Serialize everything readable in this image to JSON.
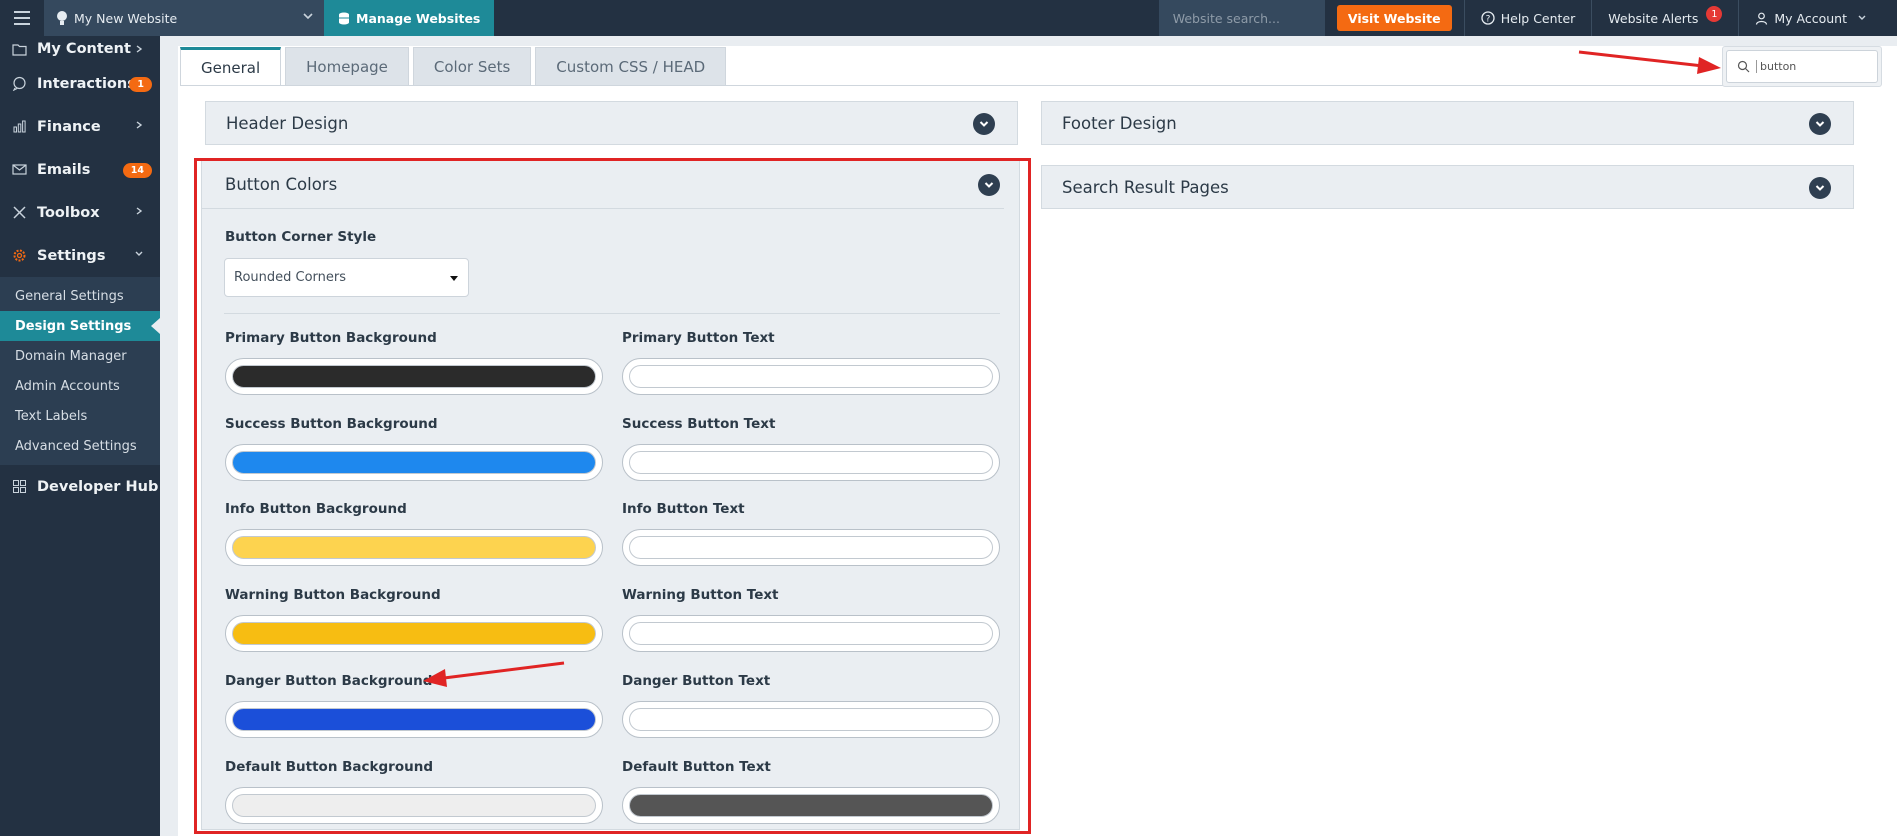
{
  "topbar": {
    "site_name": "My New Website",
    "manage_label": "Manage Websites",
    "search_placeholder": "Website search...",
    "visit_label": "Visit Website",
    "help_label": "Help Center",
    "alerts_label": "Website Alerts",
    "alerts_count": "1",
    "account_label": "My Account"
  },
  "sidebar": {
    "items": [
      {
        "label": "My Content",
        "icon": "folder-icon"
      },
      {
        "label": "Interactions",
        "icon": "chat-icon",
        "badge": "1"
      },
      {
        "label": "Finance",
        "icon": "bar-chart-icon"
      },
      {
        "label": "Emails",
        "icon": "envelope-icon",
        "badge": "14"
      },
      {
        "label": "Toolbox",
        "icon": "tools-icon"
      },
      {
        "label": "Settings",
        "icon": "gear-icon"
      }
    ],
    "settings_sub": [
      {
        "label": "General Settings"
      },
      {
        "label": "Design Settings"
      },
      {
        "label": "Domain Manager"
      },
      {
        "label": "Admin Accounts"
      },
      {
        "label": "Text Labels"
      },
      {
        "label": "Advanced Settings"
      }
    ],
    "developer_hub": "Developer Hub"
  },
  "tabs": [
    {
      "label": "General"
    },
    {
      "label": "Homepage"
    },
    {
      "label": "Color Sets"
    },
    {
      "label": "Custom CSS / HEAD"
    }
  ],
  "settings_search": {
    "value": "button"
  },
  "panels": {
    "header_design": "Header Design",
    "footer_design": "Footer Design",
    "search_result_pages": "Search Result Pages",
    "button_colors": "Button Colors"
  },
  "button_colors": {
    "corner_style_label": "Button Corner Style",
    "corner_style_value": "Rounded Corners",
    "fields": [
      {
        "label": "Primary Button Background",
        "color": "#2b2b2b"
      },
      {
        "label": "Primary Button Text",
        "color": "#ffffff"
      },
      {
        "label": "Success Button Background",
        "color": "#1e88ee"
      },
      {
        "label": "Success Button Text",
        "color": "#ffffff"
      },
      {
        "label": "Info Button Background",
        "color": "#fdd34f"
      },
      {
        "label": "Info Button Text",
        "color": "#ffffff"
      },
      {
        "label": "Warning Button Background",
        "color": "#f7bd12"
      },
      {
        "label": "Warning Button Text",
        "color": "#ffffff"
      },
      {
        "label": "Danger Button Background",
        "color": "#1b4fd9"
      },
      {
        "label": "Danger Button Text",
        "color": "#ffffff"
      },
      {
        "label": "Default Button Background",
        "color": "#eeeeee"
      },
      {
        "label": "Default Button Text",
        "color": "#555555"
      }
    ]
  },
  "colors": {
    "accent": "#1e8a98",
    "orange": "#f46a12",
    "highlight_red": "#e02424",
    "sidebar_bg": "#233142"
  }
}
